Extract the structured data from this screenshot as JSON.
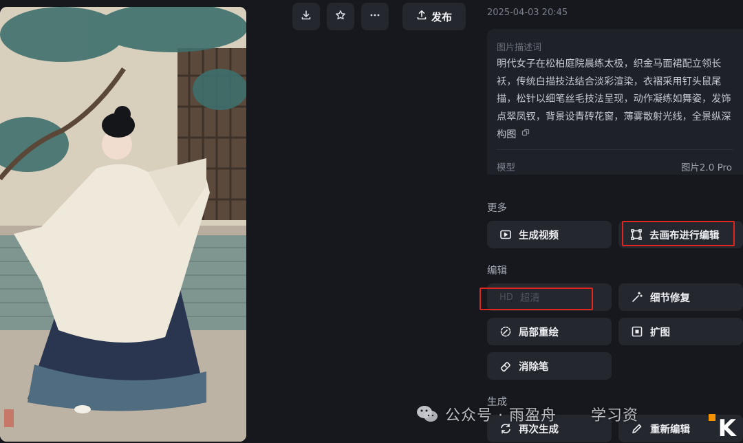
{
  "toolbar": {
    "publish_label": "发布"
  },
  "timestamp": "2025-04-03 20:45",
  "description": {
    "label": "图片描述词",
    "text": "明代女子在松柏庭院晨练太极，织金马面裙配立领长袄，传统白描技法结合淡彩渲染，衣褶采用钉头鼠尾描，松针以细笔丝毛技法呈现，动作凝练如舞姿，发饰点翠凤钗，背景设青砖花窗，薄雾散射光线，全景纵深构图",
    "model_label": "模型",
    "model_value": "图片2.0 Pro"
  },
  "sections": {
    "more": "更多",
    "edit": "编辑",
    "generate": "生成"
  },
  "buttons": {
    "generate_video": "生成视频",
    "canvas_edit": "去画布进行编辑",
    "hd_prefix": "HD",
    "hd": "超清",
    "detail_fix": "细节修复",
    "partial_redraw": "局部重绘",
    "expand": "扩图",
    "eraser": "消除笔",
    "regenerate": "再次生成",
    "reedit": "重新编辑"
  },
  "watermark": {
    "text": "公众号 · 雨盈舟",
    "text_tail": "学习资"
  },
  "corner_logo": {
    "text": "K",
    "colors": {
      "accent": "#f39200"
    }
  },
  "colors": {
    "background": "#16181e",
    "card": "#1e2128",
    "button": "#24272e",
    "highlight_red": "#e0261f"
  }
}
